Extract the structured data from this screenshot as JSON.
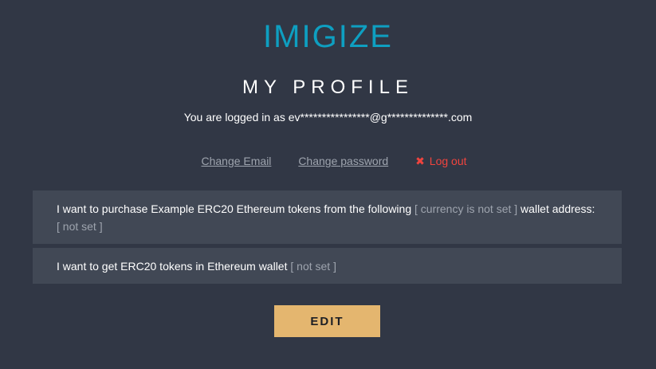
{
  "logo": {
    "text": "IMIGIZE",
    "color": "#0e9fc1"
  },
  "page_title": "MY PROFILE",
  "login": {
    "prefix": "You are logged in as",
    "email": "ev****************@g**************.com"
  },
  "links": {
    "change_email": "Change Email",
    "change_password": "Change password",
    "logout_icon": "✖",
    "logout": "Log out"
  },
  "purchase_panel": {
    "text_before": "I want to purchase Example ERC20 Ethereum tokens from the following ",
    "currency_value": "[ currency is not set ]",
    "text_after": " wallet address:",
    "address_value": "[ not set ]"
  },
  "receive_panel": {
    "text": "I want to get ERC20 tokens in Ethereum wallet ",
    "wallet_value": "[ not set ]"
  },
  "edit_button": "EDIT",
  "colors": {
    "background": "#313745",
    "panel": "#414855",
    "accent_button": "#e4b66f",
    "logout": "#f0443e",
    "muted_text": "#9ea4ae"
  }
}
